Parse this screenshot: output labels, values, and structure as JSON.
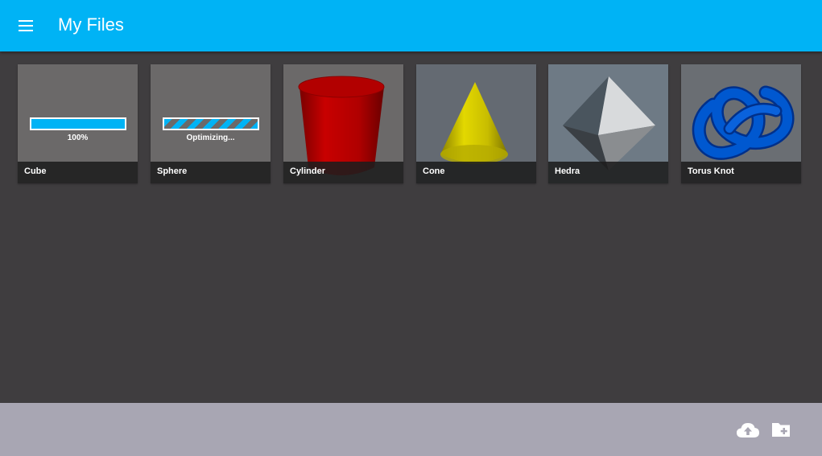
{
  "app": {
    "title": "My Files",
    "accent_color": "#00b3f5",
    "menu_icon": "hamburger-menu-icon"
  },
  "files": [
    {
      "name": "Cube",
      "status_text": "100%",
      "progress": 1.0,
      "state": "uploading"
    },
    {
      "name": "Sphere",
      "status_text": "Optimizing...",
      "state": "optimizing"
    },
    {
      "name": "Cylinder",
      "thumbnail": "red-cylinder",
      "color": "#c00000"
    },
    {
      "name": "Cone",
      "thumbnail": "yellow-cone",
      "color": "#d4c800"
    },
    {
      "name": "Hedra",
      "thumbnail": "grey-octahedron",
      "color": "#808890"
    },
    {
      "name": "Torus Knot",
      "thumbnail": "blue-torus-knot",
      "color": "#0055c8"
    }
  ],
  "footer": {
    "actions": [
      {
        "icon": "cloud-upload-icon"
      },
      {
        "icon": "new-folder-icon"
      }
    ]
  }
}
